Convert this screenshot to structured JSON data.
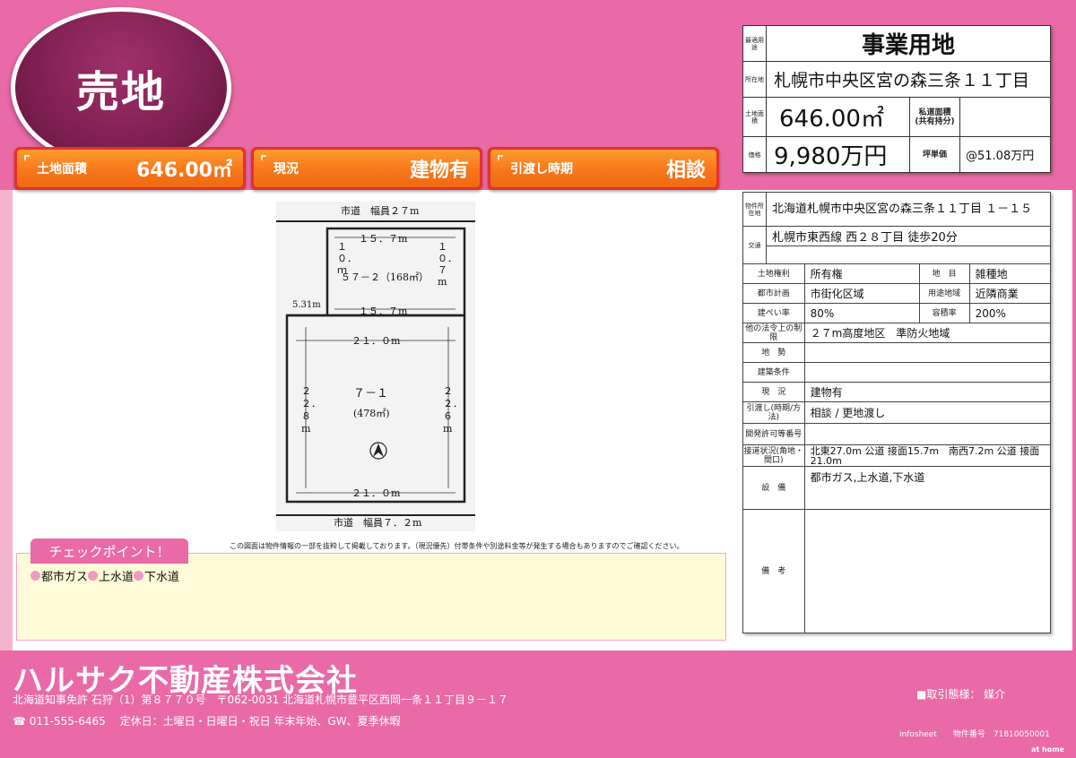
{
  "badge": "売地",
  "bars": [
    {
      "label": "土地面積",
      "value": "646.00㎡"
    },
    {
      "label": "現況",
      "value": "建物有"
    },
    {
      "label": "引渡し時期",
      "value": "相談"
    }
  ],
  "summary": {
    "purpose_label": "最適用途",
    "purpose": "事業用地",
    "location_label": "所在地",
    "location": "札幌市中央区宮の森三条１１丁目",
    "area_label": "土地面積",
    "area": "646.00㎡",
    "private_road_label": "私道面積\n(共有持分)",
    "private_road": "",
    "price_label": "価格",
    "price": "9,980万円",
    "tsubo_label": "坪単価",
    "tsubo": "@51.08万円"
  },
  "detail": {
    "address_label": "物件所在地",
    "address": "北海道札幌市中央区宮の森三条１１丁目 １－１５",
    "transport_label": "交通",
    "transport": "札幌市東西線 西２８丁目 徒歩20分",
    "transport2": "",
    "rows": [
      {
        "l1": "土地権利",
        "v1": "所有権",
        "l2": "地　目",
        "v2": "雑種地"
      },
      {
        "l1": "都市計画",
        "v1": "市街化区域",
        "l2": "用途地域",
        "v2": "近隣商業"
      },
      {
        "l1": "建ぺい率",
        "v1": "80%",
        "l2": "容積率",
        "v2": "200%"
      }
    ],
    "other_law_label": "他の法令上の制限",
    "other_law": "２７m高度地区　準防火地域",
    "terrain_label": "地　勢",
    "terrain": "",
    "building_cond_label": "建築条件",
    "building_cond": "",
    "current_label": "現　況",
    "current": "建物有",
    "delivery_label": "引渡し(時期/方法)",
    "delivery": "相談 / 更地渡し",
    "dev_permit_label": "開発許可等番号",
    "dev_permit": "",
    "road_label": "接道状況(角地・間口)",
    "road": "北東27.0m 公道 接面15.7m　南西7.2m 公道 接面21.0m",
    "facilities_label": "設　備",
    "facilities": "都市ガス,上水道,下水道",
    "remarks_label": "備　考",
    "remarks": ""
  },
  "diagram": {
    "road_top": "市道　幅員２７m",
    "road_bottom": "市道　幅員７．２m",
    "top_width": "１５．７m",
    "mid_width": "１５．７m",
    "left_offset": "5.31m",
    "upper_lot": "５７－２（168㎡）",
    "upper_side_left": "１０．ｍ",
    "upper_side_right": "１０．７m",
    "lower_width_top": "２１．０m",
    "lower_width_bottom": "２１．０m",
    "lower_lot": "７－１",
    "lower_area": "(478㎡)",
    "lower_side_left": "２２．８m",
    "lower_side_right": "２２．６m"
  },
  "notice": "この図面は物件情報の一部を抜粋して掲載しております。（現況優先）付帯条件や別途料金等が発生する場合もありますのでご確認ください。",
  "checkpoint": {
    "title": "チェックポイント！",
    "items": [
      "都市ガス",
      "上水道",
      "下水道"
    ]
  },
  "footer": {
    "company": "ハルサク不動産株式会社",
    "license": "北海道知事免許 石狩（1）第８７７０号　〒062-0031 北海道札幌市豊平区西岡一条１１丁目９－１７",
    "tel": "011-555-6465　 定休日：土曜日・日曜日・祝日 年末年始、GW、夏季休暇",
    "torihiki": "■取引態様：  媒介",
    "infosheet": "infosheet　　物件番号　71810050001",
    "athome": "at home"
  }
}
